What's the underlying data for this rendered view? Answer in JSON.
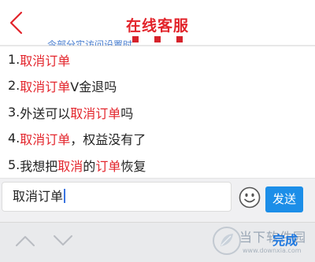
{
  "header": {
    "title": "在线客服",
    "back_icon": "chevron-left-icon",
    "accent_color": "#e2242b"
  },
  "banner": {
    "partial_text": "令部分实访问设置时"
  },
  "suggestions": [
    {
      "number": "1. ",
      "parts": [
        {
          "text": "取消订单",
          "hl": true
        }
      ]
    },
    {
      "number": "2. ",
      "parts": [
        {
          "text": "取消订单",
          "hl": true
        },
        {
          "text": "V金退吗",
          "hl": false
        }
      ]
    },
    {
      "number": "3. ",
      "parts": [
        {
          "text": "外送可以",
          "hl": false
        },
        {
          "text": "取消订单",
          "hl": true
        },
        {
          "text": "吗",
          "hl": false
        }
      ]
    },
    {
      "number": "4. ",
      "parts": [
        {
          "text": "取消订单",
          "hl": true
        },
        {
          "text": "，权益没有了",
          "hl": false
        }
      ]
    },
    {
      "number": "5. ",
      "parts": [
        {
          "text": "我想把",
          "hl": false
        },
        {
          "text": "取消",
          "hl": true
        },
        {
          "text": "的",
          "hl": false
        },
        {
          "text": "订单",
          "hl": true
        },
        {
          "text": "恢复",
          "hl": false
        }
      ]
    }
  ],
  "input": {
    "value": "取消订单"
  },
  "emoji_icon": "smiley-icon",
  "send_label": "发送",
  "send_color": "#1c8ee8",
  "keyboard_bar": {
    "up_icon": "chevron-up-icon",
    "down_icon": "chevron-down-icon",
    "done_label": "完成"
  },
  "watermark": {
    "text": "当下软件园",
    "url": "www.downxia.com",
    "icon": "leaf-logo-icon"
  }
}
